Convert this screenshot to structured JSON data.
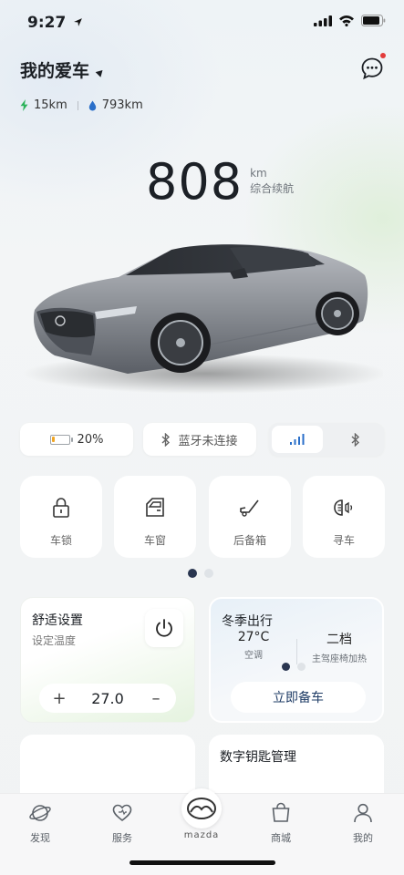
{
  "status_bar": {
    "time": "9:27"
  },
  "header": {
    "title": "我的爱车"
  },
  "ranges": {
    "electric": "15km",
    "fuel": "793km"
  },
  "main_range": {
    "value": "808",
    "unit": "km",
    "caption": "综合续航"
  },
  "chips": {
    "battery": "20%",
    "battery_level": 0.2,
    "bluetooth": "蓝牙未连接",
    "connection_selected": "cellular"
  },
  "controls": [
    {
      "label": "车锁",
      "icon": "lock-icon"
    },
    {
      "label": "车窗",
      "icon": "window-icon"
    },
    {
      "label": "后备箱",
      "icon": "trunk-icon"
    },
    {
      "label": "寻车",
      "icon": "find-car-icon"
    }
  ],
  "pager": {
    "pages": 2,
    "current": 1
  },
  "comfort": {
    "title": "舒适设置",
    "subtitle": "设定温度",
    "temperature": "27.0",
    "minus": "+",
    "plus": "–"
  },
  "season": {
    "title": "冬季出行",
    "items": [
      {
        "value": "27°C",
        "caption": "空调"
      },
      {
        "value": "二档",
        "caption": "主驾座椅加热"
      }
    ],
    "button": "立即备车"
  },
  "key_card": {
    "title": "数字钥匙管理"
  },
  "nav": [
    {
      "label": "发现",
      "icon": "planet-icon"
    },
    {
      "label": "服务",
      "icon": "heart-icon"
    },
    {
      "label": "",
      "icon": "mazda-logo-icon"
    },
    {
      "label": "商城",
      "icon": "shopping-bag-icon"
    },
    {
      "label": "我的",
      "icon": "person-icon"
    }
  ],
  "brand_word": "mazda",
  "colors": {
    "accent": "#1f3c66",
    "battery": "#f0a626",
    "electric": "#2bb35a",
    "fuel": "#2a6fc9",
    "notification": "#e23b3b"
  }
}
